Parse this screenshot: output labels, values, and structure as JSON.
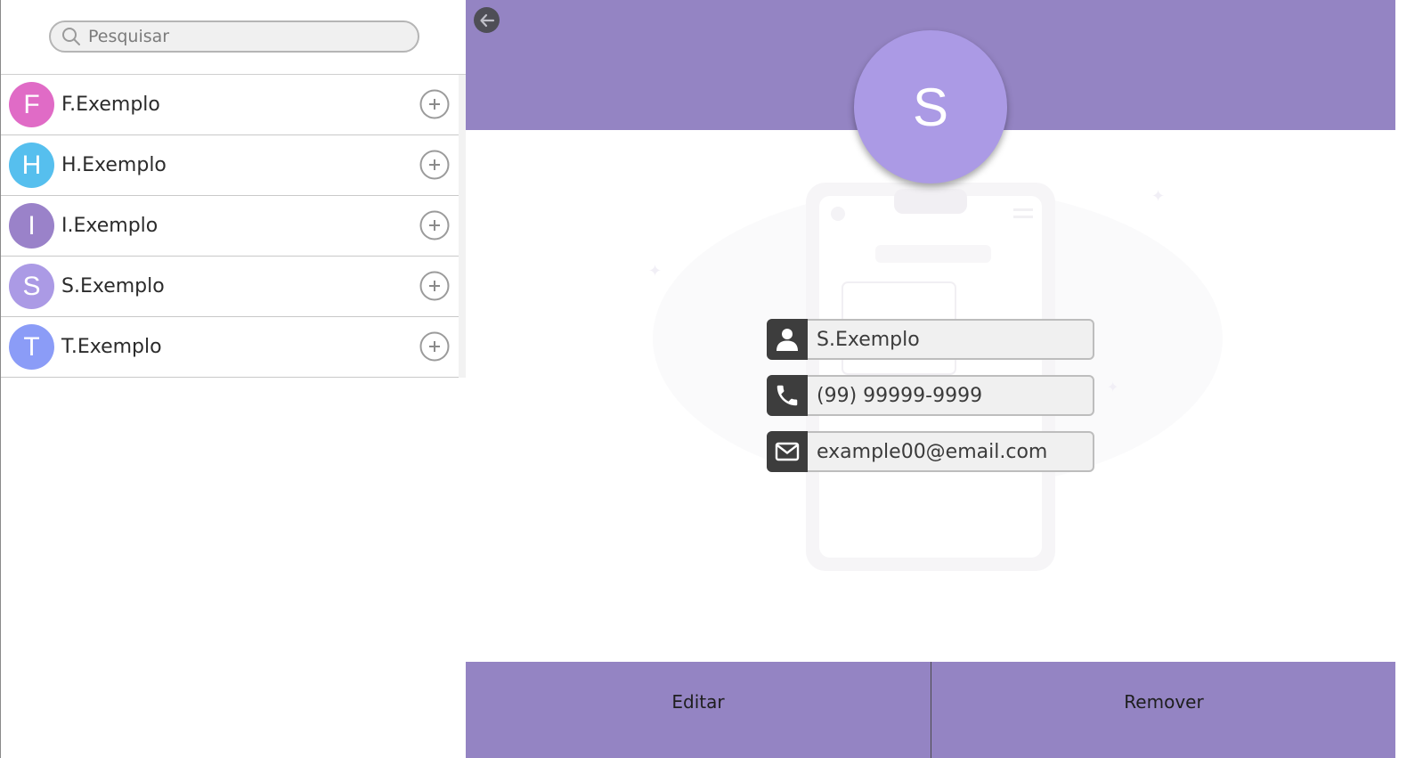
{
  "search": {
    "placeholder": "Pesquisar",
    "icon": "search-icon"
  },
  "contacts": [
    {
      "initial": "F",
      "name": "F.Exemplo",
      "color": "#e06bc6"
    },
    {
      "initial": "H",
      "name": "H.Exemplo",
      "color": "#56bfee"
    },
    {
      "initial": "I",
      "name": "I.Exemplo",
      "color": "#9a82c9"
    },
    {
      "initial": "S",
      "name": "S.Exemplo",
      "color": "#ab9ae5"
    },
    {
      "initial": "T",
      "name": "T.Exemplo",
      "color": "#8b9cf7"
    }
  ],
  "detail": {
    "initial": "S",
    "name": "S.Exemplo",
    "phone": "(99) 99999-9999",
    "email": "example00@email.com",
    "accent_color": "#9484c3",
    "avatar_color": "#ab9ae5"
  },
  "footer": {
    "edit_label": "Editar",
    "remove_label": "Remover"
  }
}
